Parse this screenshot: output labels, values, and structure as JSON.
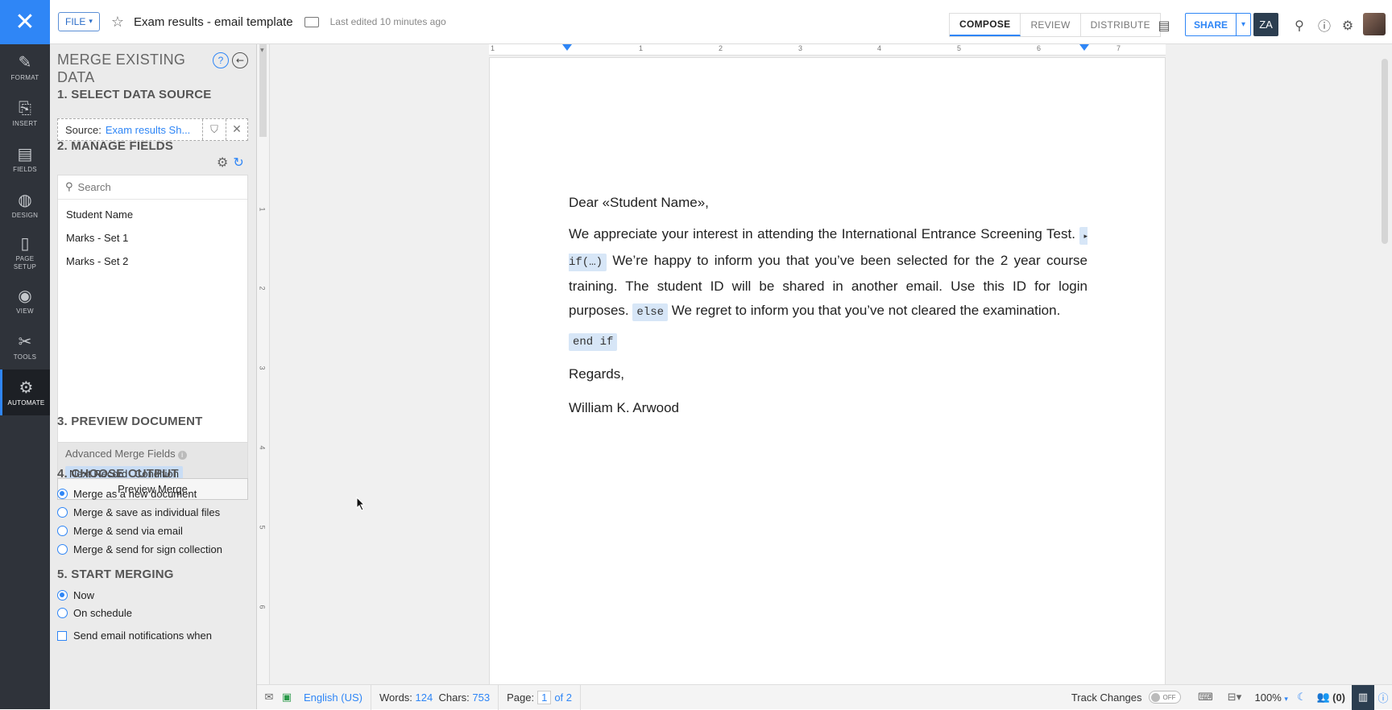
{
  "topbar": {
    "close_glyph": "✕",
    "file_label": "FILE",
    "title": "Exam results - email template",
    "last_edited": "Last edited 10 minutes ago",
    "tabs": [
      "COMPOSE",
      "REVIEW",
      "DISTRIBUTE"
    ],
    "share_label": "SHARE",
    "zw_label": "ZA"
  },
  "rail": {
    "items": [
      {
        "label": "FORMAT",
        "icon": "format-icon"
      },
      {
        "label": "INSERT",
        "icon": "insert-icon"
      },
      {
        "label": "FIELDS",
        "icon": "fields-icon"
      },
      {
        "label": "DESIGN",
        "icon": "design-icon"
      },
      {
        "label": "PAGE SETUP",
        "icon": "page-setup-icon"
      },
      {
        "label": "VIEW",
        "icon": "view-icon"
      },
      {
        "label": "TOOLS",
        "icon": "tools-icon"
      },
      {
        "label": "AUTOMATE",
        "icon": "automate-icon"
      }
    ]
  },
  "panel": {
    "title": "MERGE EXISTING DATA",
    "sec1": "1. SELECT DATA SOURCE",
    "source_label": "Source:",
    "source_value": "Exam results Sh...",
    "sec2": "2. MANAGE FIELDS",
    "search_placeholder": "Search",
    "fields": [
      "Student Name",
      "Marks - Set 1",
      "Marks - Set 2"
    ],
    "adv_title": "Advanced Merge Fields",
    "adv_chips": [
      "Next Record",
      "Condition"
    ],
    "sec3": "3. PREVIEW DOCUMENT",
    "preview_btn": "Preview Merge",
    "sec4": "4. CHOOSE OUTPUT",
    "outputs": [
      "Merge as a new document",
      "Merge & save as individual files",
      "Merge & send via email",
      "Merge & send for sign collection"
    ],
    "sec5": "5. START MERGING",
    "start": [
      "Now",
      "On schedule"
    ],
    "notify": "Send email notifications when"
  },
  "ruler": {
    "h_ticks": [
      "1",
      "1",
      "2",
      "3",
      "4",
      "5",
      "6",
      "7"
    ],
    "v_ticks": [
      "1",
      "2",
      "3",
      "4",
      "5",
      "6"
    ]
  },
  "document": {
    "greeting": "Dear «Student Name»,",
    "line1": "We appreciate your interest in attending the International Entrance Screening Test.",
    "if_tag": "if(…)",
    "if_text": "We’re happy to inform you that you’ve been selected for the 2 year course training. The student ID will be shared in another email. Use this ID for login purposes.",
    "else_tag": "else",
    "else_text": "We regret to inform you that you’ve not cleared the examination.",
    "endif_tag": "end if",
    "regards": "Regards,",
    "signature": "William K. Arwood"
  },
  "status": {
    "language": "English (US)",
    "words_label": "Words:",
    "words": "124",
    "chars_label": "Chars:",
    "chars": "753",
    "page_label": "Page:",
    "page_current": "1",
    "page_of": "of 2",
    "track_changes": "Track Changes",
    "toggle": "OFF",
    "zoom": "100%",
    "collab": "(0)"
  },
  "colors": {
    "accent": "#2f86f6",
    "rail_bg": "#2f333a",
    "panel_bg": "#ebebeb"
  }
}
